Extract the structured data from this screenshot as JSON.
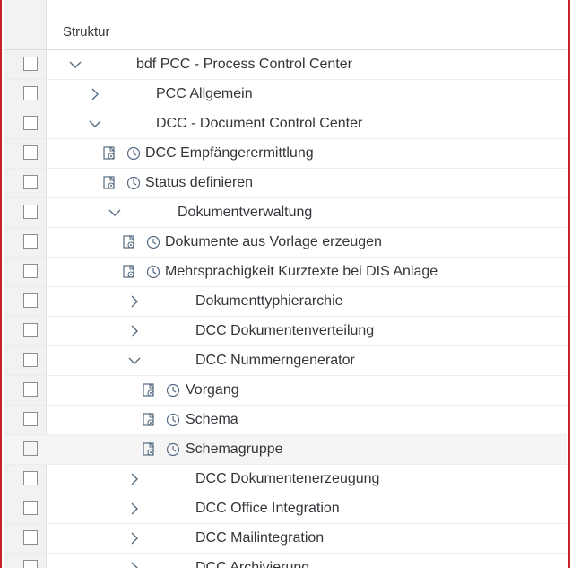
{
  "header": {
    "column_label": "Struktur"
  },
  "rows": [
    {
      "label": "bdf PCC - Process Control Center"
    },
    {
      "label": "PCC Allgemein"
    },
    {
      "label": "DCC - Document Control Center"
    },
    {
      "label": "DCC Empfängerermittlung"
    },
    {
      "label": "Status definieren"
    },
    {
      "label": "Dokumentverwaltung"
    },
    {
      "label": "Dokumente aus Vorlage erzeugen"
    },
    {
      "label": "Mehrsprachigkeit Kurztexte bei DIS Anlage"
    },
    {
      "label": "Dokumenttyphierarchie"
    },
    {
      "label": "DCC Dokumentenverteilung"
    },
    {
      "label": "DCC Nummerngenerator"
    },
    {
      "label": "Vorgang"
    },
    {
      "label": "Schema"
    },
    {
      "label": "Schemagruppe"
    },
    {
      "label": "DCC Dokumentenerzeugung"
    },
    {
      "label": "DCC Office Integration"
    },
    {
      "label": "DCC Mailintegration"
    },
    {
      "label": "DCC Archivierung"
    }
  ],
  "icons": {
    "expanded": "chevron-down-icon",
    "collapsed": "chevron-right-icon",
    "execute": "execute-icon",
    "history": "history-icon"
  }
}
